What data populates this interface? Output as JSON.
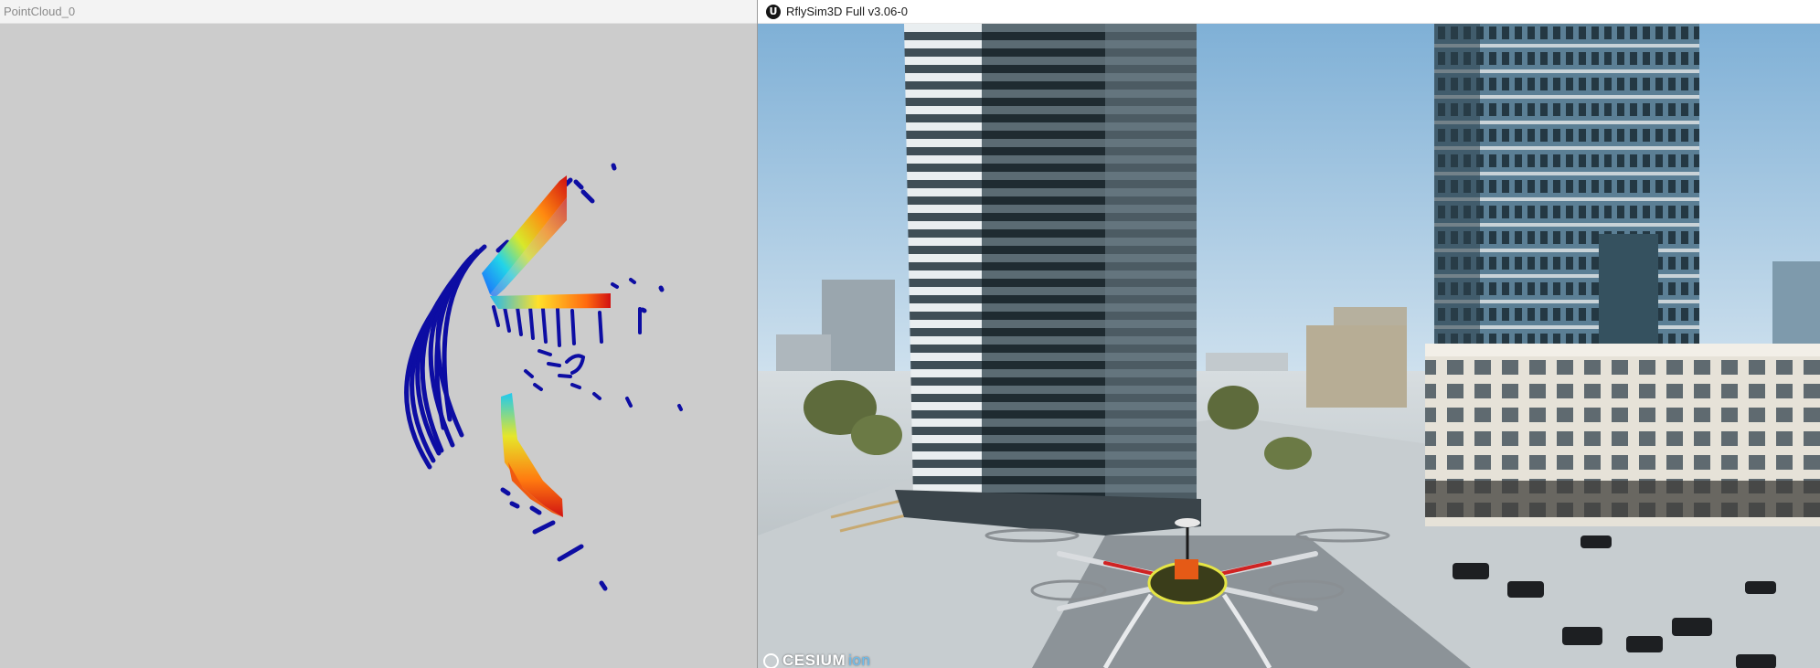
{
  "windows": {
    "pointcloud": {
      "title": "PointCloud_0"
    },
    "rflysim": {
      "title": "RflySim3D Full v3.06-0",
      "logo_glyph": "U",
      "watermark": {
        "brand": "CESIUM",
        "suffix": "ion"
      }
    }
  },
  "colors": {
    "pointcloud_background": "#cccccc",
    "point_far": "#0d0da3",
    "point_near": "#d11111"
  }
}
